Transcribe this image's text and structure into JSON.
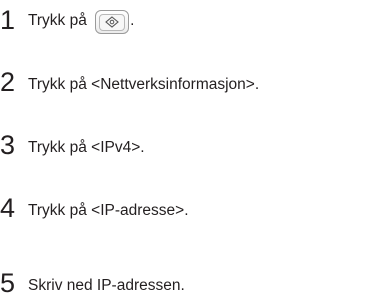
{
  "steps": [
    {
      "number": "1",
      "text_before": "Trykk på",
      "icon": "settings-menu-key-icon",
      "text_after": "."
    },
    {
      "number": "2",
      "text": "Trykk på <Nettverksinformasjon>."
    },
    {
      "number": "3",
      "text": "Trykk på <IPv4>."
    },
    {
      "number": "4",
      "text": "Trykk på <IP-adresse>."
    },
    {
      "number": "5",
      "text": "Skriv ned IP-adressen."
    }
  ]
}
